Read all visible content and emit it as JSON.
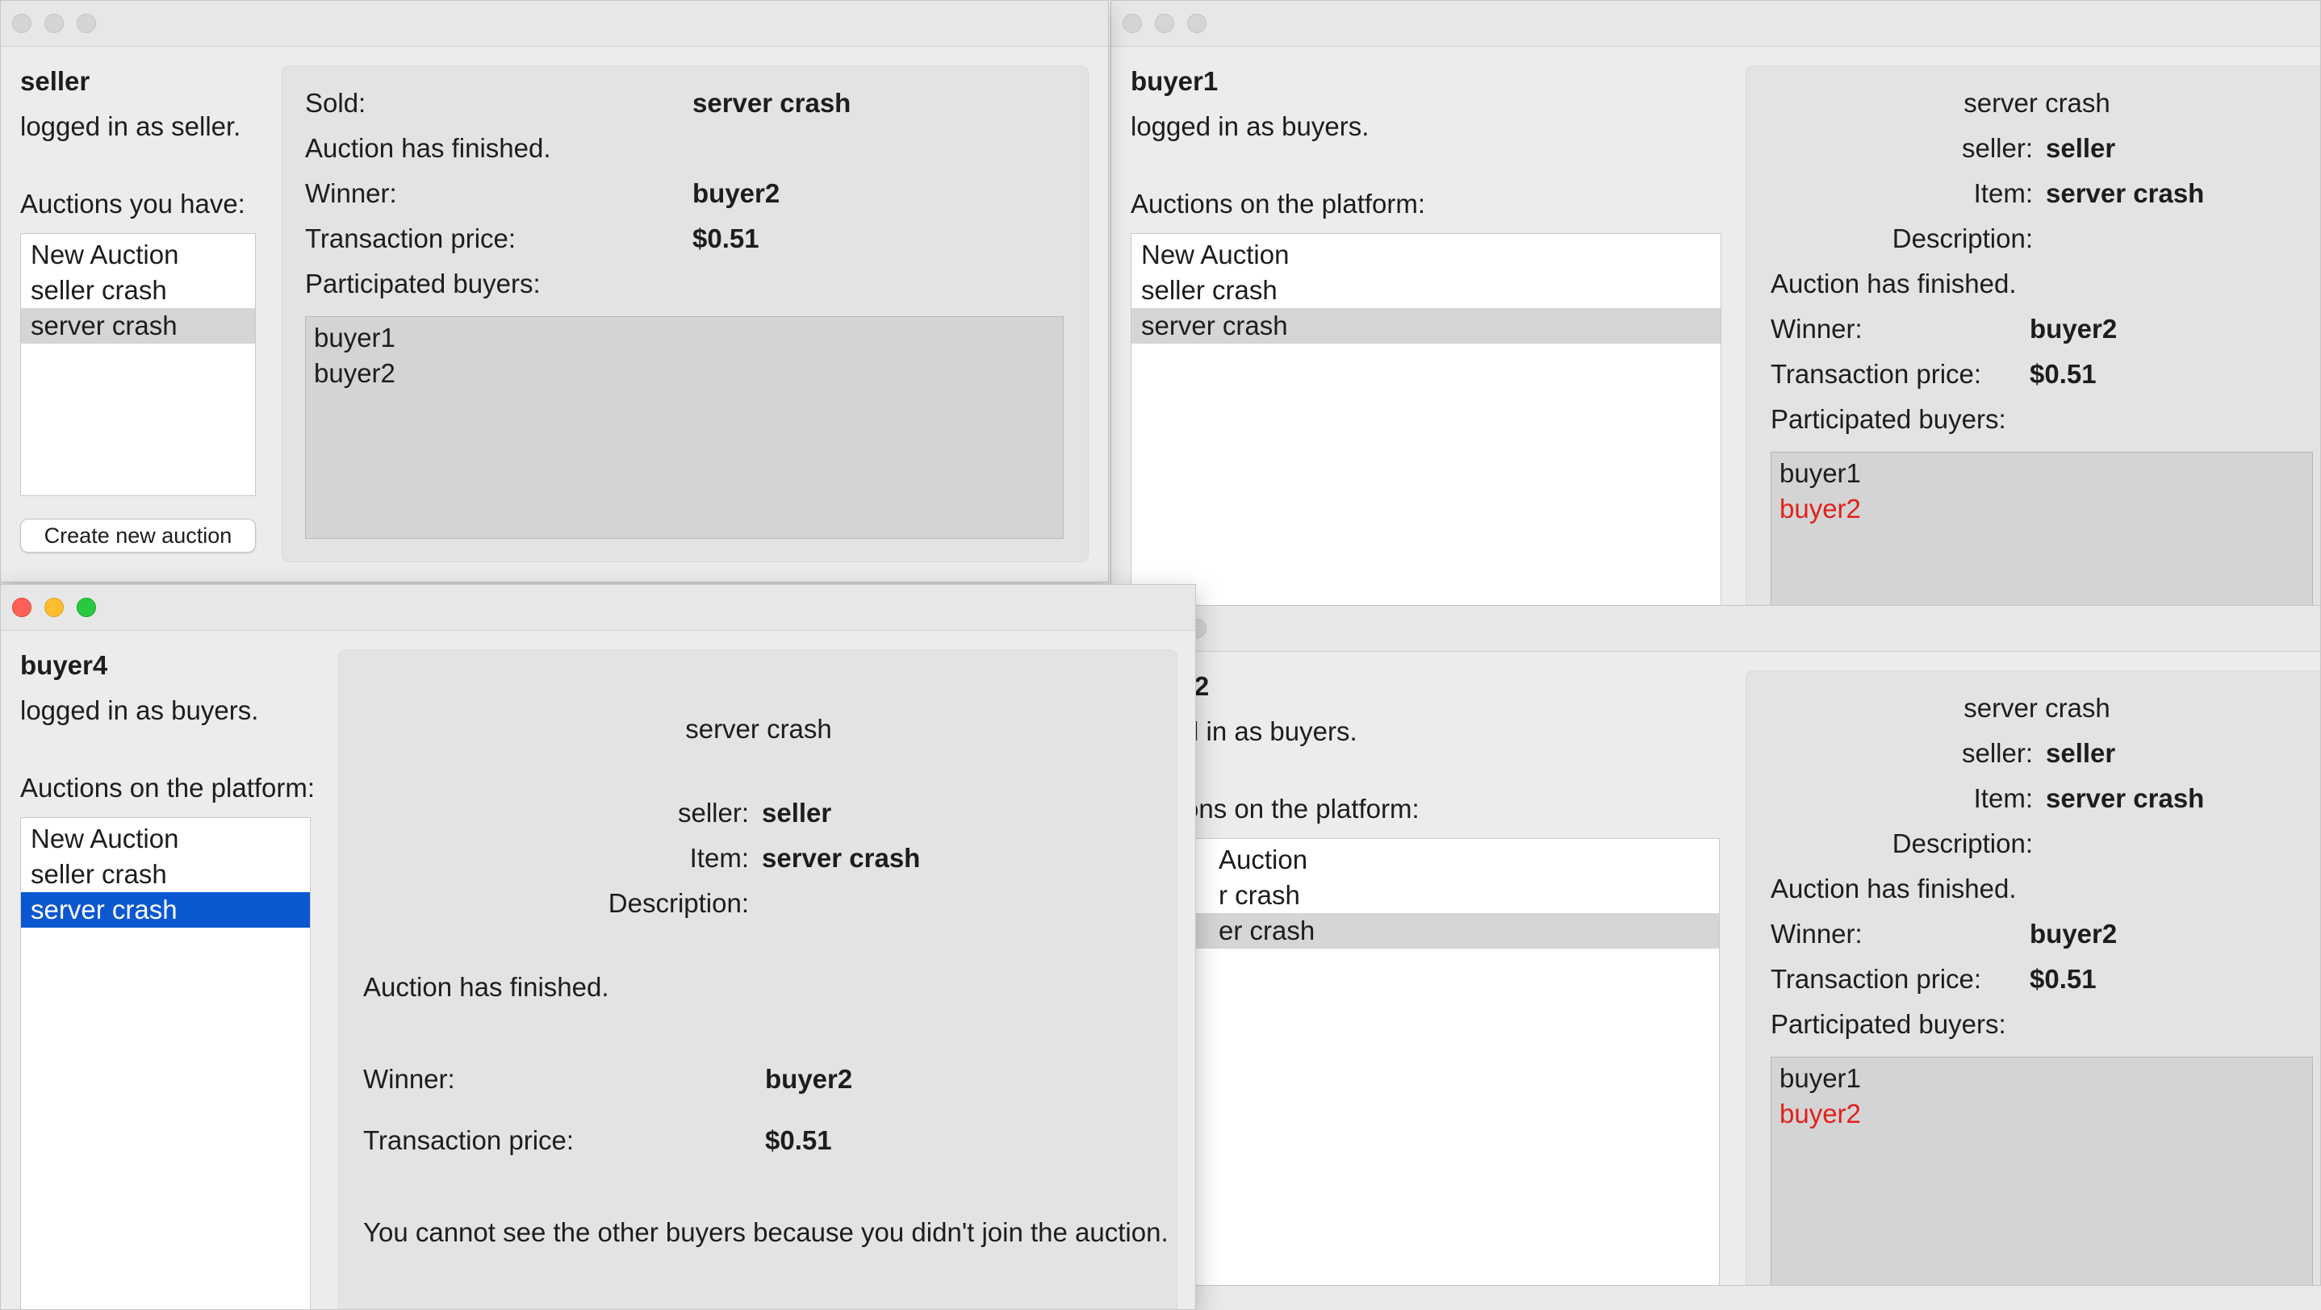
{
  "seller_window": {
    "username": "seller",
    "status": "logged in as seller.",
    "list_label": "Auctions you have:",
    "auctions": [
      "New Auction",
      "seller crash",
      "server crash"
    ],
    "create_button": "Create new auction",
    "detail": {
      "sold_label": "Sold:",
      "sold_value": "server crash",
      "finished": "Auction has finished.",
      "winner_label": "Winner:",
      "winner_value": "buyer2",
      "price_label": "Transaction price:",
      "price_value": "$0.51",
      "participants_label": "Participated buyers:",
      "participants": [
        "buyer1",
        "buyer2"
      ]
    }
  },
  "buyer1_window": {
    "username": "buyer1",
    "status": "logged in as buyers.",
    "list_label": "Auctions on the platform:",
    "auctions": [
      "New Auction",
      "seller crash",
      "server crash"
    ],
    "detail": {
      "title": "server crash",
      "seller_label": "seller:",
      "seller_value": "seller",
      "item_label": "Item:",
      "item_value": "server crash",
      "description_label": "Description:",
      "finished": "Auction has finished.",
      "winner_label": "Winner:",
      "winner_value": "buyer2",
      "price_label": "Transaction price:",
      "price_value": "$0.51",
      "participants_label": "Participated buyers:",
      "participants": [
        "buyer1",
        "buyer2"
      ]
    }
  },
  "buyer2_window": {
    "username_visible": "r2",
    "status_visible": "d in as buyers.",
    "list_label_visible": "ons on the platform:",
    "auctions_visible": [
      "Auction",
      "r crash",
      "er crash"
    ],
    "detail": {
      "title": "server crash",
      "seller_label": "seller:",
      "seller_value": "seller",
      "item_label": "Item:",
      "item_value": "server crash",
      "description_label": "Description:",
      "finished": "Auction has finished.",
      "winner_label": "Winner:",
      "winner_value": "buyer2",
      "price_label": "Transaction price:",
      "price_value": "$0.51",
      "participants_label": "Participated buyers:",
      "participants": [
        "buyer1",
        "buyer2"
      ]
    }
  },
  "buyer4_window": {
    "username": "buyer4",
    "status": "logged in as buyers.",
    "list_label": "Auctions on the platform:",
    "auctions": [
      "New Auction",
      "seller crash",
      "server crash"
    ],
    "detail": {
      "title": "server crash",
      "seller_label": "seller:",
      "seller_value": "seller",
      "item_label": "Item:",
      "item_value": "server crash",
      "description_label": "Description:",
      "finished": "Auction has finished.",
      "winner_label": "Winner:",
      "winner_value": "buyer2",
      "price_label": "Transaction price:",
      "price_value": "$0.51",
      "notice": "You cannot see the other buyers because you didn't join the auction."
    }
  },
  "colors": {
    "winner_highlight": "#e0211b",
    "selection_blue": "#0b57d0",
    "selection_gray": "#d5d5d5"
  }
}
